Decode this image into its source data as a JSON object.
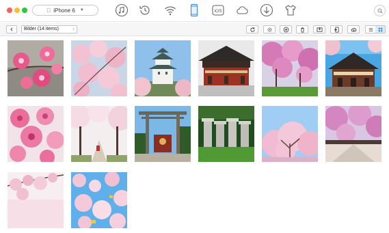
{
  "window": {
    "device_name": "iPhone 6"
  },
  "toolbar": {
    "icons": [
      "music-icon",
      "history-icon",
      "wifi-sync-icon",
      "phone-icon",
      "ios-icon",
      "cloud-icon",
      "download-icon",
      "shirt-icon"
    ],
    "active_icon": "phone-icon"
  },
  "subbar": {
    "album_select": "Bilder (14 items)"
  },
  "colors": {
    "accent": "#3b8fe6",
    "active_view_bg": "#dce9f7"
  },
  "photos": [
    {
      "subject": "cherry blossom closeup"
    },
    {
      "subject": "cherry blossom branches"
    },
    {
      "subject": "castle with blossoms"
    },
    {
      "subject": "temple building"
    },
    {
      "subject": "blossom trees in park"
    },
    {
      "subject": "shrine with blue sky"
    },
    {
      "subject": "pink blossoms closeup"
    },
    {
      "subject": "blossom tunnel path"
    },
    {
      "subject": "torii gate"
    },
    {
      "subject": "stone lanterns"
    },
    {
      "subject": "blossom tree blue sky"
    },
    {
      "subject": "blossom promenade"
    },
    {
      "subject": "blossom branch soft pink"
    },
    {
      "subject": "blossoms against sky"
    }
  ]
}
